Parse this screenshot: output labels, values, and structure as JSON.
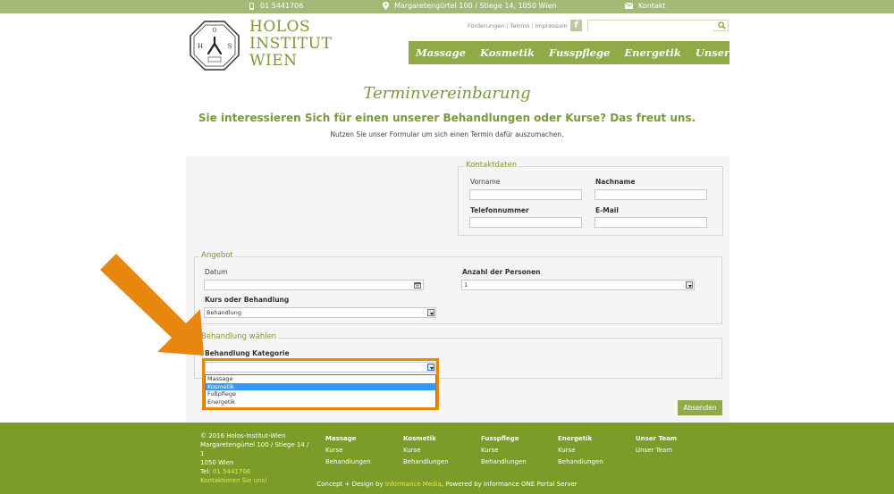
{
  "topbar": {
    "phone": "01 5441706",
    "address": "Margaretengürtel 100 / Stiege 14, 1050 Wien",
    "contact": "Kontakt"
  },
  "logo": {
    "line1": "HOLOS",
    "line2": "INSTITUT",
    "line3": "WIEN"
  },
  "toplinks": [
    "Förderungen",
    "Termin",
    "Impressum"
  ],
  "search": {
    "placeholder": ""
  },
  "nav": [
    "Massage",
    "Kosmetik",
    "Fusspflege",
    "Energetik",
    "Unser Team"
  ],
  "page": {
    "title": "Terminvereinbarung",
    "subtitle": "Sie interessieren Sich für einen unserer Behandlungen oder Kurse? Das freut uns.",
    "intro": "Nutzen Sie unser Formular um sich einen Termin dafür auszumachen."
  },
  "kontakt": {
    "legend": "Kontaktdaten",
    "vorname": "Vorname",
    "nachname": "Nachname",
    "telefon": "Telefonnummer",
    "email": "E-Mail"
  },
  "angebot": {
    "legend": "Angebot",
    "datum": "Datum",
    "anzahl": "Anzahl der Personen",
    "anzahl_value": "1",
    "kurs_label": "Kurs oder Behandlung",
    "kurs_value": "Behandlung"
  },
  "behandlung": {
    "legend": "Behandlung wählen",
    "kategorie_label": "Behandlung Kategorie",
    "kategorie_value": "",
    "options": [
      "Massage",
      "Kosmetik",
      "Fußpflege",
      "Energetik"
    ],
    "selected_index": 1
  },
  "submit": "Absenden",
  "footer": {
    "copyright": "© 2016 Holos-Institut-Wien",
    "address1": "Margaretengürtel 100 / Stiege 14 / 1",
    "address2": "1050 Wien",
    "tel_label": "Tel:",
    "tel": "01 5441706",
    "cta": "Kontaktieren Sie uns!",
    "columns": [
      {
        "title": "Massage",
        "links": [
          "Kurse",
          "Behandlungen"
        ]
      },
      {
        "title": "Kosmetik",
        "links": [
          "Kurse",
          "Behandlungen"
        ]
      },
      {
        "title": "Fusspflege",
        "links": [
          "Kurse",
          "Behandlungen"
        ]
      },
      {
        "title": "Energetik",
        "links": [
          "Kurse",
          "Behandlungen"
        ]
      },
      {
        "title": "Unser Team",
        "links": [
          "Unser Team"
        ]
      }
    ],
    "credit_pre": "Concept + Design by",
    "credit_agency": "Informance Media",
    "credit_post": ", Powered by Informance ONE Portal Server"
  },
  "colors": {
    "accent": "#8faa46",
    "topbar": "#a3b978",
    "footer": "#7c9c2a",
    "highlight": "#e8870f",
    "selected_option": "#3399ff"
  }
}
